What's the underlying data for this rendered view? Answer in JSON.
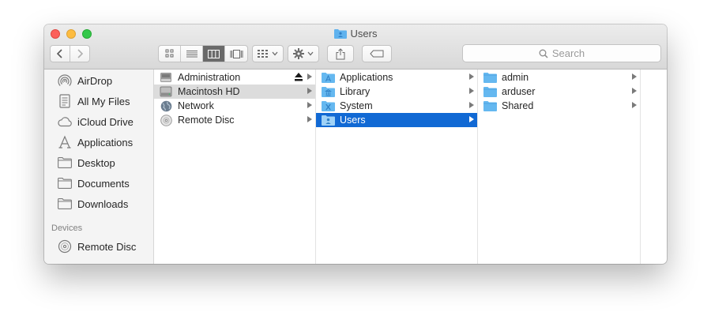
{
  "window": {
    "title": "Users"
  },
  "toolbar": {
    "view_modes": [
      "icon-view",
      "list-view",
      "column-view",
      "coverflow-view"
    ],
    "active_view": "column-view",
    "search_placeholder": "Search"
  },
  "sidebar": {
    "favorites": [
      {
        "label": "AirDrop",
        "icon": "airdrop-icon"
      },
      {
        "label": "All My Files",
        "icon": "all-files-icon"
      },
      {
        "label": "iCloud Drive",
        "icon": "cloud-icon"
      },
      {
        "label": "Applications",
        "icon": "applications-icon"
      },
      {
        "label": "Desktop",
        "icon": "folder-icon"
      },
      {
        "label": "Documents",
        "icon": "folder-icon"
      },
      {
        "label": "Downloads",
        "icon": "folder-icon"
      }
    ],
    "devices_heading": "Devices",
    "devices": [
      {
        "label": "Remote Disc",
        "icon": "disc-icon"
      }
    ]
  },
  "columns": [
    {
      "items": [
        {
          "label": "Administration",
          "icon": "drive-icon",
          "eject": true
        },
        {
          "label": "Macintosh HD",
          "icon": "hard-drive-icon",
          "state": "grey"
        },
        {
          "label": "Network",
          "icon": "network-globe-icon"
        },
        {
          "label": "Remote Disc",
          "icon": "disc-icon"
        }
      ]
    },
    {
      "items": [
        {
          "label": "Applications",
          "icon": "applications-folder-icon"
        },
        {
          "label": "Library",
          "icon": "library-folder-icon"
        },
        {
          "label": "System",
          "icon": "system-folder-icon"
        },
        {
          "label": "Users",
          "icon": "users-folder-icon",
          "state": "selected"
        }
      ]
    },
    {
      "items": [
        {
          "label": "admin",
          "icon": "folder-icon"
        },
        {
          "label": "arduser",
          "icon": "folder-icon"
        },
        {
          "label": "Shared",
          "icon": "folder-icon"
        }
      ]
    }
  ],
  "colors": {
    "selection": "#1169d4",
    "folder": "#65b8f0",
    "close": "#fc605b",
    "minimize": "#fdbc40",
    "maximize": "#34c84a"
  }
}
